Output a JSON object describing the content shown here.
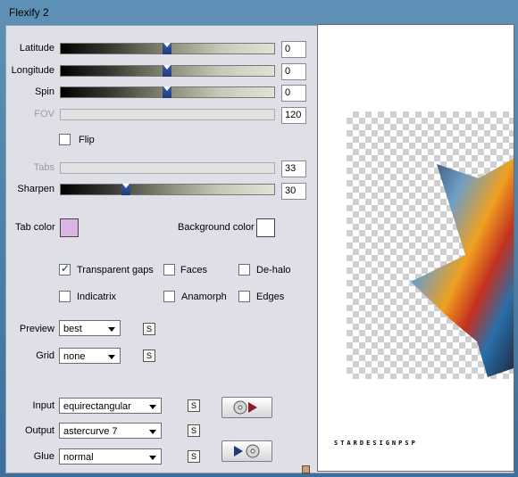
{
  "window": {
    "title": "Flexify 2"
  },
  "sliders": [
    {
      "label": "Latitude",
      "value": "0",
      "level": 0.5,
      "enabled": true
    },
    {
      "label": "Longitude",
      "value": "0",
      "level": 0.5,
      "enabled": true
    },
    {
      "label": "Spin",
      "value": "0",
      "level": 0.5,
      "enabled": true
    },
    {
      "label": "FOV",
      "value": "120",
      "level": null,
      "enabled": false
    },
    {
      "label": "Tabs",
      "value": "33",
      "level": null,
      "enabled": false
    },
    {
      "label": "Sharpen",
      "value": "30",
      "level": 0.3,
      "enabled": true
    }
  ],
  "flip": {
    "label": "Flip",
    "checked": false
  },
  "tab_color": {
    "label": "Tab color",
    "color": "#dcb4e4"
  },
  "background_color": {
    "label": "Background color",
    "color": "#ffffff"
  },
  "options": {
    "transparent_gaps": {
      "label": "Transparent gaps",
      "checked": true
    },
    "faces": {
      "label": "Faces",
      "checked": false
    },
    "de_halo": {
      "label": "De-halo",
      "checked": false
    },
    "indicatrix": {
      "label": "Indicatrix",
      "checked": false
    },
    "anamorph": {
      "label": "Anamorph",
      "checked": false
    },
    "edges": {
      "label": "Edges",
      "checked": false
    }
  },
  "preview": {
    "label": "Preview",
    "value": "best",
    "s_label": "S"
  },
  "grid": {
    "label": "Grid",
    "value": "none",
    "s_label": "S"
  },
  "input": {
    "label": "Input",
    "value": "equirectangular",
    "s_label": "S"
  },
  "output": {
    "label": "Output",
    "value": "astercurve 7",
    "s_label": "S"
  },
  "glue": {
    "label": "Glue",
    "value": "normal",
    "s_label": "S"
  },
  "preview_pane": {
    "signature": "STARDESIGNPSP"
  }
}
